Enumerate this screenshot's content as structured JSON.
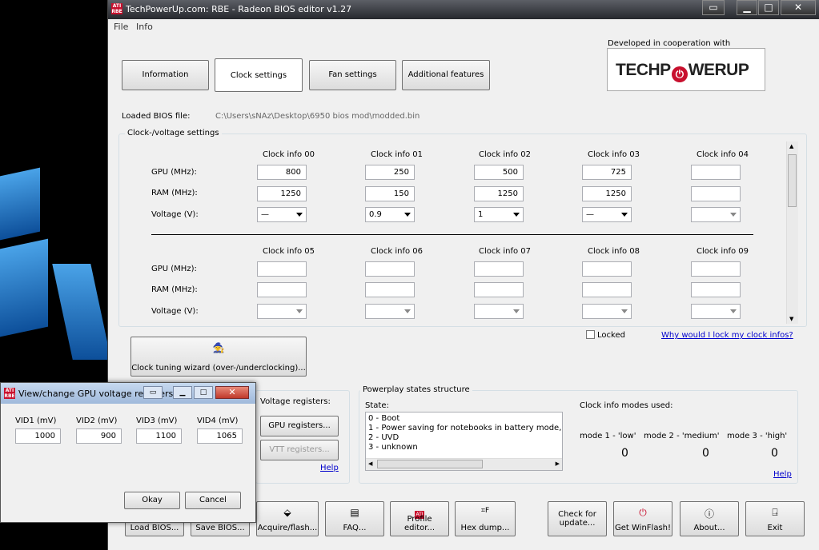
{
  "window": {
    "title": "TechPowerUp.com: RBE - Radeon BIOS editor v1.27",
    "menu": [
      "File",
      "Info"
    ]
  },
  "logo": {
    "caption": "Developed in cooperation with",
    "text_left": "TECHP",
    "text_right": "WERUP"
  },
  "tabs": [
    "Information",
    "Clock settings",
    "Fan settings",
    "Additional features"
  ],
  "bios": {
    "label": "Loaded BIOS file:",
    "path": "C:\\Users\\sNAz\\Desktop\\6950 bios mod\\modded.bin"
  },
  "clock_group": {
    "title": "Clock-/voltage settings",
    "row_labels": {
      "gpu": "GPU (MHz):",
      "ram": "RAM (MHz):",
      "voltage": "Voltage (V):"
    },
    "infos_top": [
      {
        "name": "Clock info 00",
        "gpu": "800",
        "ram": "1250",
        "voltage": "—"
      },
      {
        "name": "Clock info 01",
        "gpu": "250",
        "ram": "150",
        "voltage": "0.9"
      },
      {
        "name": "Clock info 02",
        "gpu": "500",
        "ram": "1250",
        "voltage": "1"
      },
      {
        "name": "Clock info 03",
        "gpu": "725",
        "ram": "1250",
        "voltage": "—"
      },
      {
        "name": "Clock info 04",
        "gpu": "",
        "ram": "",
        "voltage": ""
      }
    ],
    "infos_bottom": [
      {
        "name": "Clock info 05"
      },
      {
        "name": "Clock info 06"
      },
      {
        "name": "Clock info 07"
      },
      {
        "name": "Clock info 08"
      },
      {
        "name": "Clock info 09"
      }
    ],
    "locked_label": "Locked",
    "why_link": "Why would I lock my clock infos?",
    "wizard_label": "Clock tuning wizard (over-/underclocking)..."
  },
  "voltage_registers": {
    "title": "Voltage registers:",
    "gpu_btn": "GPU registers...",
    "vtt_btn": "VTT registers...",
    "help": "Help"
  },
  "powerplay": {
    "title": "Powerplay states structure",
    "state_label": "State:",
    "states": [
      "0 - Boot",
      "1 - Power saving for notebooks in battery mode, High p",
      "2 - UVD",
      "3 - unknown"
    ],
    "modes_label": "Clock info modes used:",
    "modes": [
      {
        "name": "mode 1 - 'low'",
        "value": "0"
      },
      {
        "name": "mode 2 - 'medium'",
        "value": "0"
      },
      {
        "name": "mode 3 - 'high'",
        "value": "0"
      }
    ],
    "help": "Help"
  },
  "bottom_buttons": [
    {
      "label": "Load BIOS...",
      "icon": "folder-icon"
    },
    {
      "label": "Save BIOS...",
      "icon": "disk-icon"
    },
    {
      "label": "Acquire/flash...",
      "icon": "chip-icon"
    },
    {
      "label": "FAQ...",
      "icon": "document-icon"
    },
    {
      "label": "Profile editor...",
      "icon": "ati-icon"
    },
    {
      "label": "Hex dump...",
      "icon": "hex-icon"
    },
    {
      "label": "Check for update...",
      "icon": ""
    },
    {
      "label": "Get WinFlash!",
      "icon": "power-icon"
    },
    {
      "label": "About...",
      "icon": "info-icon"
    },
    {
      "label": "Exit",
      "icon": "exit-icon"
    }
  ],
  "dialog": {
    "title": "View/change GPU voltage registers...",
    "vids": [
      {
        "label": "VID1 (mV)",
        "value": "1000"
      },
      {
        "label": "VID2 (mV)",
        "value": "900"
      },
      {
        "label": "VID3 (mV)",
        "value": "1100"
      },
      {
        "label": "VID4 (mV)",
        "value": "1065"
      }
    ],
    "okay": "Okay",
    "cancel": "Cancel"
  },
  "colors": {
    "accent_red": "#c8102e",
    "link_blue": "#0000cc",
    "window_bg": "#f0f0f0"
  }
}
